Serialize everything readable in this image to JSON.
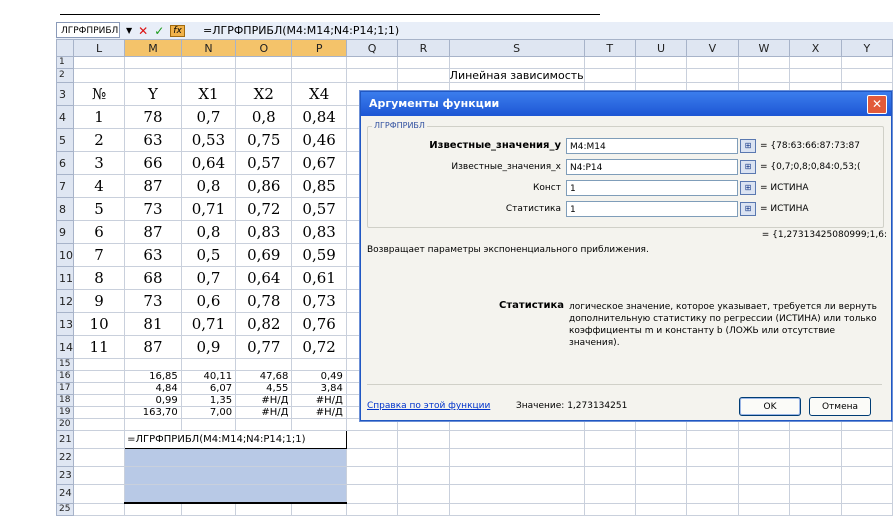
{
  "formula_bar": {
    "name_box": "ЛГРФПРИБЛ",
    "cancel_glyph": "✕",
    "enter_glyph": "✓",
    "fx_glyph": "fx",
    "formula": "=ЛГРФПРИБЛ(M4:M14;N4:P14;1;1)"
  },
  "columns": [
    "L",
    "M",
    "N",
    "O",
    "P",
    "Q",
    "R",
    "S",
    "T",
    "U",
    "V",
    "W",
    "X",
    "Y"
  ],
  "row_numbers": [
    "1",
    "2",
    "3",
    "4",
    "5",
    "6",
    "7",
    "8",
    "9",
    "10",
    "11",
    "12",
    "13",
    "14",
    "15",
    "16",
    "17",
    "18",
    "19",
    "20",
    "21",
    "22",
    "23",
    "24",
    "25"
  ],
  "cells": {
    "s2": "Линейная зависимость",
    "header_row": [
      "№",
      "Y",
      "X1",
      "X2",
      "X4"
    ],
    "data_rows": [
      [
        "1",
        "78",
        "0,7",
        "0,8",
        "0,84"
      ],
      [
        "2",
        "63",
        "0,53",
        "0,75",
        "0,46"
      ],
      [
        "3",
        "66",
        "0,64",
        "0,57",
        "0,67"
      ],
      [
        "4",
        "87",
        "0,8",
        "0,86",
        "0,85"
      ],
      [
        "5",
        "73",
        "0,71",
        "0,72",
        "0,57"
      ],
      [
        "6",
        "87",
        "0,8",
        "0,83",
        "0,83"
      ],
      [
        "7",
        "63",
        "0,5",
        "0,69",
        "0,59"
      ],
      [
        "8",
        "68",
        "0,7",
        "0,64",
        "0,61"
      ],
      [
        "9",
        "73",
        "0,6",
        "0,78",
        "0,73"
      ],
      [
        "10",
        "81",
        "0,71",
        "0,82",
        "0,76"
      ],
      [
        "11",
        "87",
        "0,9",
        "0,77",
        "0,72"
      ]
    ],
    "stats_rows": [
      [
        "16,85",
        "40,11",
        "47,68",
        "0,49"
      ],
      [
        "4,84",
        "6,07",
        "4,55",
        "3,84"
      ],
      [
        "0,99",
        "1,35",
        "#Н/Д",
        "#Н/Д"
      ],
      [
        "163,70",
        "7,00",
        "#Н/Д",
        "#Н/Д"
      ]
    ],
    "m21_formula": "=ЛГРФПРИБЛ(M4:M14;N4:P14;1;1)"
  },
  "dialog": {
    "title": "Аргументы функции",
    "close_glyph": "✕",
    "group_label": "ЛГРФПРИБЛ",
    "args": [
      {
        "label": "Известные_значения_y",
        "value": "M4:M14",
        "result": "= {78:63:66:87:73:87"
      },
      {
        "label": "Известные_значения_x",
        "value": "N4:P14",
        "result": "= {0,7;0,8;0,84:0,53;("
      },
      {
        "label": "Конст",
        "value": "1",
        "result": "= ИСТИНА"
      },
      {
        "label": "Статистика",
        "value": "1",
        "result": "= ИСТИНА"
      }
    ],
    "range_btn_glyph": "⊞",
    "total_result": "= {1,27313425080999;1,6:",
    "description": "Возвращает параметры экспоненциального приближения.",
    "arg_name": "Статистика",
    "arg_description": "логическое значение, которое указывает, требуется ли вернуть дополнительную статистику по регрессии (ИСТИНА) или только коэффициенты m и константу b (ЛОЖЬ или отсутствие значения).",
    "help_link": "Справка по этой функции",
    "value_label": "Значение: 1,273134251",
    "ok_label": "OK",
    "cancel_label": "Отмена"
  }
}
